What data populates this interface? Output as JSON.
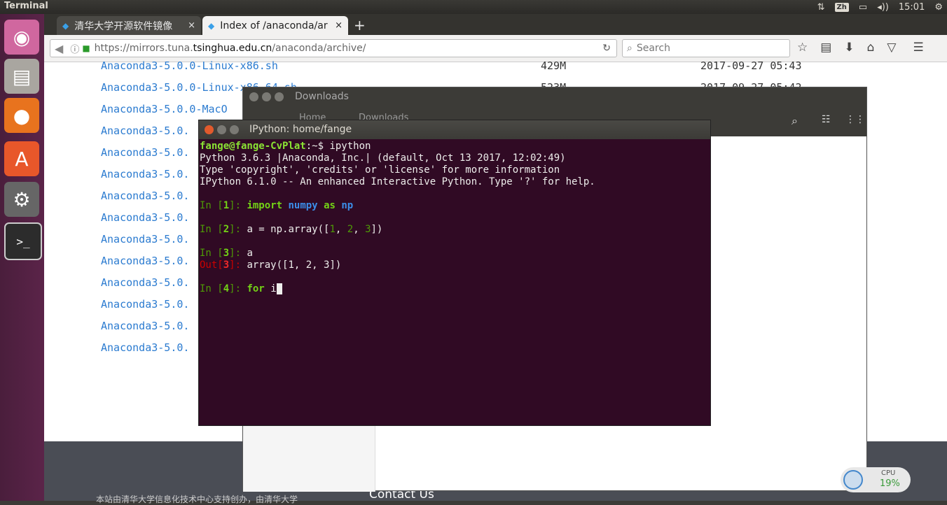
{
  "topbar": {
    "app_title": "Terminal",
    "ime": "Zh",
    "volume": "◂))",
    "time": "15:01"
  },
  "launcher": {
    "items": [
      "ubuntu-dash",
      "files",
      "firefox",
      "software-center",
      "system-settings",
      "terminal"
    ]
  },
  "browser": {
    "tabs": [
      {
        "label": "清华大学开源软件镜像",
        "close": "×"
      },
      {
        "label": "Index of /anaconda/ar",
        "close": "×"
      }
    ],
    "new_tab": "+",
    "url_prefix": "https://mirrors.tuna.",
    "url_domain": "tsinghua.edu.cn",
    "url_path": "/anaconda/archive/",
    "search_placeholder": "Search"
  },
  "listing": {
    "rows": [
      {
        "name": "Anaconda3-5.0.0-Linux-x86.sh",
        "size": "429M",
        "date": "2017-09-27 05:43"
      },
      {
        "name": "Anaconda3-5.0.0-Linux-x86_64.sh",
        "size": "523M",
        "date": "2017-09-27 05:42"
      },
      {
        "name": "Anaconda3-5.0.0-MacO"
      },
      {
        "name": "Anaconda3-5.0."
      },
      {
        "name": "Anaconda3-5.0."
      },
      {
        "name": "Anaconda3-5.0."
      },
      {
        "name": "Anaconda3-5.0."
      },
      {
        "name": "Anaconda3-5.0."
      },
      {
        "name": "Anaconda3-5.0."
      },
      {
        "name": "Anaconda3-5.0."
      },
      {
        "name": "Anaconda3-5.0."
      },
      {
        "name": "Anaconda3-5.0."
      },
      {
        "name": "Anaconda3-5.0."
      },
      {
        "name": "Anaconda3-5.0."
      }
    ]
  },
  "footer": {
    "contact": "Contact Us",
    "credit": "本站由清华大学信息化技术中心支持创办，由清华大学"
  },
  "downloads_window": {
    "title": "Downloads",
    "crumb_home": "Home",
    "crumb_current": "Downloads"
  },
  "terminal": {
    "title": "IPython: home/fange",
    "prompt_user": "fange@fange-CvPlat",
    "prompt_path": ":~$ ",
    "command": "ipython",
    "banner": [
      "Python 3.6.3 |Anaconda, Inc.| (default, Oct 13 2017, 12:02:49)",
      "Type 'copyright', 'credits' or 'license' for more information",
      "IPython 6.1.0 -- An enhanced Interactive Python. Type '?' for help."
    ],
    "in_label": "In [",
    "out_label": "Out[",
    "label_close": "]: ",
    "cells": [
      {
        "n": "1",
        "kw1": "import",
        "mod": "numpy",
        "kw2": "as",
        "alias": "np"
      },
      {
        "n": "2",
        "code": "a = np.array([",
        "v1": "1",
        "v2": "2",
        "v3": "3",
        "end": "])",
        "sep": ", "
      },
      {
        "n": "3",
        "code": "a",
        "out": "array([1, 2, 3])"
      },
      {
        "n": "4",
        "kw": "for",
        "typed": "i"
      }
    ]
  },
  "cpu_widget": {
    "label": "CPU",
    "value": "19%"
  }
}
